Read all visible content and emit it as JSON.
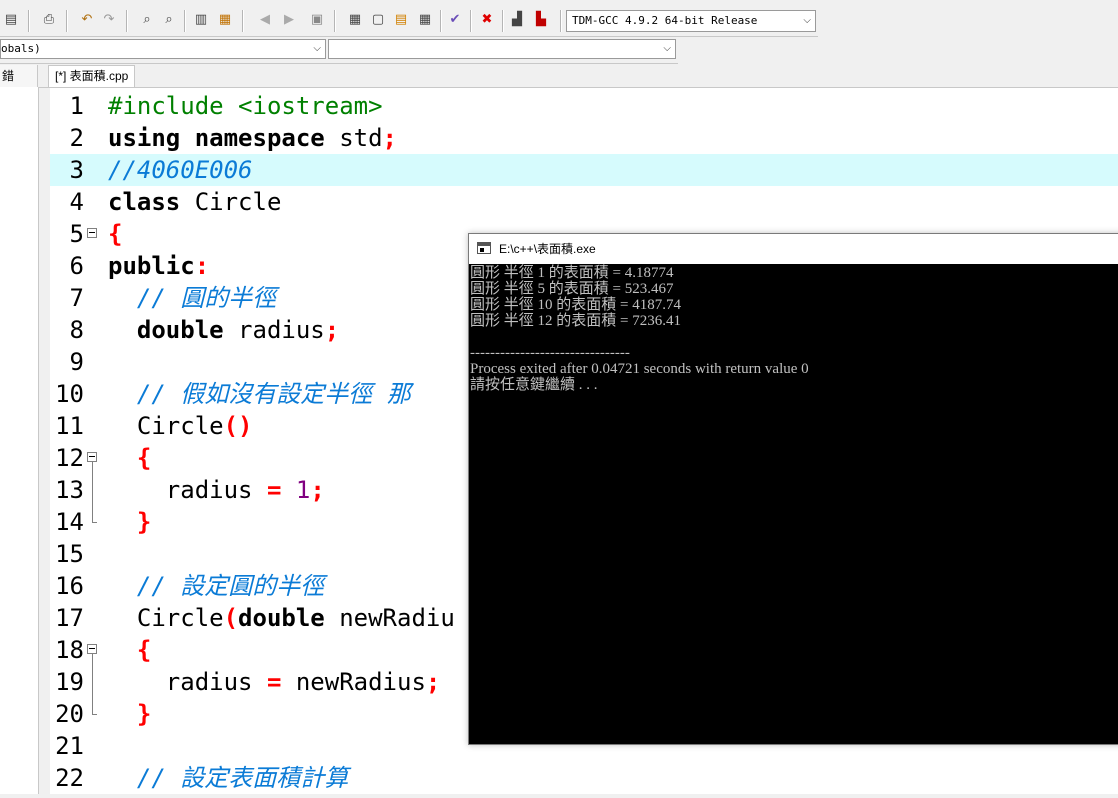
{
  "toolbar": {
    "compiler": "TDM-GCC 4.9.2 64-bit Release",
    "icons": [
      "save-all-icon",
      "print-icon",
      "undo-icon",
      "redo-icon",
      "find-icon",
      "replace-icon",
      "indent-icon",
      "unindent-icon",
      "bookmark-prev-icon",
      "bookmark-next-icon",
      "toggle-comment-icon",
      "new-project-icon",
      "window-icon",
      "class-browser-icon",
      "tile-icon",
      "check-syntax-icon",
      "close-icon",
      "chart-icon",
      "delete-chart-icon"
    ]
  },
  "classbar": {
    "scope": "obals)",
    "member": ""
  },
  "left_panel": {
    "tab_label": "錯"
  },
  "editor": {
    "file_tab": "[*] 表面積.cpp",
    "highlight_line": 3,
    "lines": [
      {
        "n": "1",
        "t": [
          {
            "c": "pp",
            "s": "#include <iostream>"
          }
        ]
      },
      {
        "n": "2",
        "t": [
          {
            "c": "kw",
            "s": "using namespace"
          },
          {
            "c": "plain",
            "s": " std"
          },
          {
            "c": "sym",
            "s": ";"
          }
        ]
      },
      {
        "n": "3",
        "t": [
          {
            "c": "cm",
            "s": "//4060E006"
          }
        ]
      },
      {
        "n": "4",
        "t": [
          {
            "c": "kw",
            "s": "class"
          },
          {
            "c": "plain",
            "s": " Circle"
          }
        ]
      },
      {
        "n": "5",
        "t": [
          {
            "c": "sym",
            "s": "{"
          }
        ]
      },
      {
        "n": "6",
        "t": [
          {
            "c": "kw",
            "s": "public"
          },
          {
            "c": "sym",
            "s": ":"
          }
        ]
      },
      {
        "n": "7",
        "t": [
          {
            "c": "plain",
            "s": "  "
          },
          {
            "c": "cm",
            "s": "// 圓的半徑"
          }
        ]
      },
      {
        "n": "8",
        "t": [
          {
            "c": "plain",
            "s": "  "
          },
          {
            "c": "kw",
            "s": "double"
          },
          {
            "c": "plain",
            "s": " radius"
          },
          {
            "c": "sym",
            "s": ";"
          }
        ]
      },
      {
        "n": "9",
        "t": []
      },
      {
        "n": "10",
        "t": [
          {
            "c": "plain",
            "s": "  "
          },
          {
            "c": "cm",
            "s": "// 假如沒有設定半徑 那"
          }
        ]
      },
      {
        "n": "11",
        "t": [
          {
            "c": "plain",
            "s": "  Circle"
          },
          {
            "c": "sym",
            "s": "()"
          }
        ]
      },
      {
        "n": "12",
        "t": [
          {
            "c": "plain",
            "s": "  "
          },
          {
            "c": "sym",
            "s": "{"
          }
        ]
      },
      {
        "n": "13",
        "t": [
          {
            "c": "plain",
            "s": "    radius "
          },
          {
            "c": "sym",
            "s": "="
          },
          {
            "c": "plain",
            "s": " "
          },
          {
            "c": "num",
            "s": "1"
          },
          {
            "c": "sym",
            "s": ";"
          }
        ]
      },
      {
        "n": "14",
        "t": [
          {
            "c": "plain",
            "s": "  "
          },
          {
            "c": "sym",
            "s": "}"
          }
        ]
      },
      {
        "n": "15",
        "t": []
      },
      {
        "n": "16",
        "t": [
          {
            "c": "plain",
            "s": "  "
          },
          {
            "c": "cm",
            "s": "// 設定圓的半徑"
          }
        ]
      },
      {
        "n": "17",
        "t": [
          {
            "c": "plain",
            "s": "  Circle"
          },
          {
            "c": "sym",
            "s": "("
          },
          {
            "c": "kw",
            "s": "double"
          },
          {
            "c": "plain",
            "s": " newRadiu"
          }
        ]
      },
      {
        "n": "18",
        "t": [
          {
            "c": "plain",
            "s": "  "
          },
          {
            "c": "sym",
            "s": "{"
          }
        ]
      },
      {
        "n": "19",
        "t": [
          {
            "c": "plain",
            "s": "    radius "
          },
          {
            "c": "sym",
            "s": "="
          },
          {
            "c": "plain",
            "s": " newRadius"
          },
          {
            "c": "sym",
            "s": ";"
          }
        ]
      },
      {
        "n": "20",
        "t": [
          {
            "c": "plain",
            "s": "  "
          },
          {
            "c": "sym",
            "s": "}"
          }
        ]
      },
      {
        "n": "21",
        "t": []
      },
      {
        "n": "22",
        "t": [
          {
            "c": "plain",
            "s": "  "
          },
          {
            "c": "cm",
            "s": "// 設定表面積計算"
          }
        ]
      }
    ]
  },
  "console": {
    "title": "E:\\c++\\表面積.exe",
    "output": [
      "圓形 半徑 1 的表面積 = 4.18774",
      "圓形 半徑 5 的表面積 = 523.467",
      "圓形 半徑 10 的表面積 = 4187.74",
      "圓形 半徑 12 的表面積 = 7236.41",
      "",
      "--------------------------------",
      "Process exited after 0.04721 seconds with return value 0",
      "請按任意鍵繼續 . . ."
    ]
  }
}
